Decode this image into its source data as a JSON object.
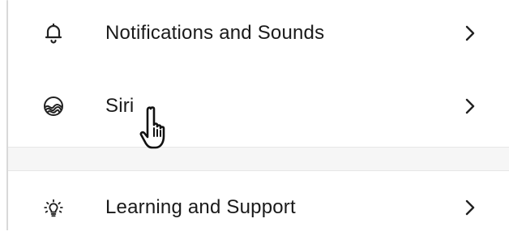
{
  "settings_list": {
    "items": [
      {
        "label": "Notifications and Sounds",
        "icon": "bell-icon",
        "chevron": "chevron-right-icon"
      },
      {
        "label": "Siri",
        "icon": "siri-icon",
        "chevron": "chevron-right-icon"
      },
      {
        "label": "Learning and Support",
        "icon": "lightbulb-icon",
        "chevron": "chevron-right-icon"
      }
    ]
  },
  "colors": {
    "text": "#1a1a1a",
    "icon": "#222222",
    "section_gap": "#f6f6f6",
    "divider": "#e6e6e6"
  },
  "pointer": {
    "icon": "hand-pointer-icon"
  }
}
